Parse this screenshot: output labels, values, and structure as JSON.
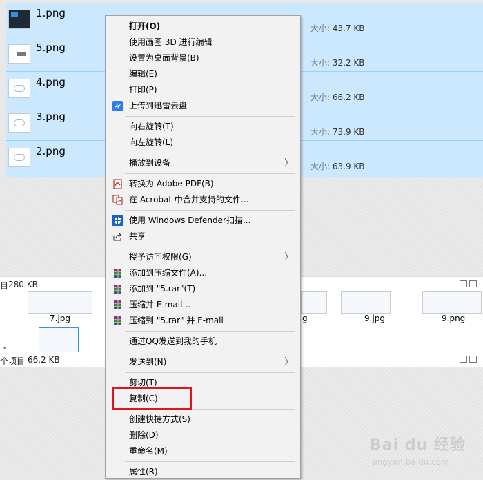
{
  "files": [
    {
      "name": "1.png",
      "size_label": "大小:",
      "size": "43.7 KB",
      "thumb": "dark"
    },
    {
      "name": "5.png",
      "size_label": "大小:",
      "size": "32.2 KB",
      "thumb": "light"
    },
    {
      "name": "4.png",
      "size_label": "大小:",
      "size": "66.2 KB",
      "thumb": "light"
    },
    {
      "name": "3.png",
      "size_label": "大小:",
      "size": "73.9 KB",
      "thumb": "light"
    },
    {
      "name": "2.png",
      "size_label": "大小:",
      "size": "63.9 KB",
      "thumb": "light"
    }
  ],
  "status_top": {
    "left_text": "目",
    "size": "280 KB"
  },
  "grid_items": [
    "7.jpg",
    "g",
    "9.jpg",
    "9.png"
  ],
  "status_bottom": {
    "left_text": "个项目",
    "size": "66.2 KB"
  },
  "menu": {
    "items": [
      {
        "label": "打开(O)",
        "bold": true,
        "icon": ""
      },
      {
        "label": "使用画图 3D 进行编辑",
        "icon": ""
      },
      {
        "label": "设置为桌面背景(B)",
        "icon": ""
      },
      {
        "label": "编辑(E)",
        "icon": ""
      },
      {
        "label": "打印(P)",
        "icon": ""
      },
      {
        "label": "上传到迅雷云盘",
        "icon": "thunder-cloud-icon"
      },
      {
        "sep": true
      },
      {
        "label": "向右旋转(T)",
        "icon": ""
      },
      {
        "label": "向左旋转(L)",
        "icon": ""
      },
      {
        "sep": true
      },
      {
        "label": "播放到设备",
        "icon": "",
        "submenu": true
      },
      {
        "sep": true
      },
      {
        "label": "转换为 Adobe PDF(B)",
        "icon": "adobe-pdf-icon"
      },
      {
        "label": "在 Acrobat 中合并支持的文件...",
        "icon": "acrobat-combine-icon"
      },
      {
        "sep": true
      },
      {
        "label": "使用 Windows Defender扫描...",
        "icon": "windows-defender-icon"
      },
      {
        "label": "共享",
        "icon": "share-icon"
      },
      {
        "sep": true
      },
      {
        "label": "授予访问权限(G)",
        "icon": "",
        "submenu": true
      },
      {
        "label": "添加到压缩文件(A)...",
        "icon": "winrar-icon"
      },
      {
        "label": "添加到 \"5.rar\"(T)",
        "icon": "winrar-icon"
      },
      {
        "label": "压缩并 E-mail...",
        "icon": "winrar-icon"
      },
      {
        "label": "压缩到 \"5.rar\" 并 E-mail",
        "icon": "winrar-icon"
      },
      {
        "sep": true
      },
      {
        "label": "通过QQ发送到我的手机",
        "icon": ""
      },
      {
        "sep": true
      },
      {
        "label": "发送到(N)",
        "icon": "",
        "submenu": true
      },
      {
        "sep": true
      },
      {
        "label": "剪切(T)",
        "icon": ""
      },
      {
        "label": "复制(C)",
        "icon": "",
        "highlighted": true
      },
      {
        "sep": true
      },
      {
        "label": "创建快捷方式(S)",
        "icon": ""
      },
      {
        "label": "删除(D)",
        "icon": ""
      },
      {
        "label": "重命名(M)",
        "icon": ""
      },
      {
        "sep": true
      },
      {
        "label": "属性(R)",
        "icon": ""
      }
    ],
    "submenu_glyph": "〉"
  },
  "watermark": {
    "brand": "Bai du 经验",
    "url": "jingyan.baidu.com"
  },
  "colors": {
    "selection": "#cce8ff",
    "highlight_box": "#e0161e",
    "menu_bg": "#f2f2f2"
  }
}
